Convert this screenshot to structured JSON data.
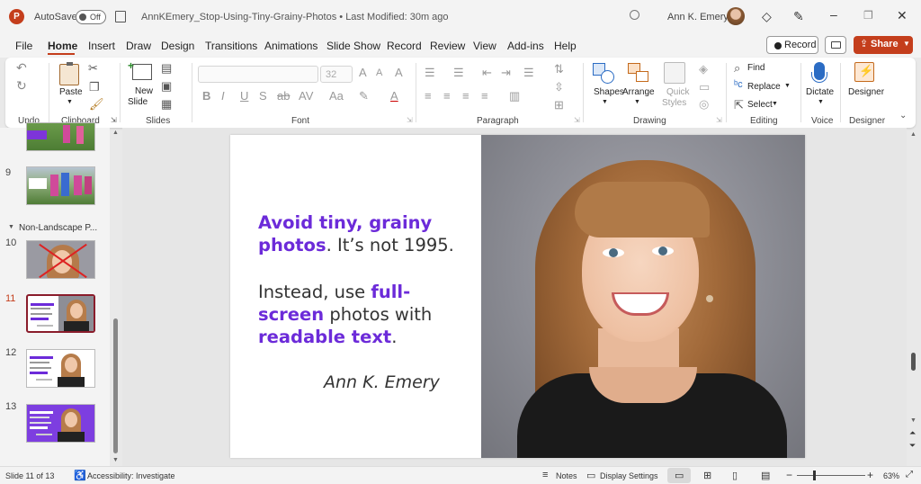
{
  "titlebar": {
    "autosave_label": "AutoSave",
    "autosave_state": "Off",
    "doc_title": "AnnKEmery_Stop-Using-Tiny-Grainy-Photos • Last Modified: 30m ago",
    "user_name": "Ann K. Emery",
    "app_icon": "powerpoint-icon"
  },
  "menu": {
    "tabs": [
      "File",
      "Home",
      "Insert",
      "Draw",
      "Design",
      "Transitions",
      "Animations",
      "Slide Show",
      "Record",
      "Review",
      "View",
      "Add-ins",
      "Help"
    ],
    "active": "Home",
    "record_button": "Record",
    "share_button": "Share"
  },
  "ribbon": {
    "groups": [
      "Undo",
      "Clipboard",
      "Slides",
      "Font",
      "Paragraph",
      "Drawing",
      "Editing",
      "Voice",
      "Designer"
    ],
    "paste": "Paste",
    "new_slide": "New",
    "new_slide2": "Slide",
    "font_size": "32",
    "shapes": "Shapes",
    "arrange": "Arrange",
    "quick_styles": "Quick",
    "quick_styles2": "Styles",
    "find": "Find",
    "replace": "Replace",
    "select": "Select",
    "dictate": "Dictate",
    "designer": "Designer"
  },
  "thumbnails": {
    "slide_numbers": [
      "9",
      "10",
      "11",
      "12",
      "13"
    ],
    "section_label": "Non-Landscape P...",
    "current": "11"
  },
  "slide": {
    "line1a": "Avoid tiny, grainy",
    "line2a": "photos",
    "line2b": ". It’s not 1995.",
    "line3a": "Instead, use ",
    "line3b": "full-",
    "line4a": "screen",
    "line4b": " photos with",
    "line5a": "readable text",
    "line5b": ".",
    "author": "Ann K. Emery"
  },
  "status": {
    "slide_info": "Slide 11 of 13",
    "accessibility": "Accessibility: Investigate",
    "notes": "Notes",
    "display_settings": "Display Settings",
    "zoom": "63%"
  },
  "colors": {
    "accent": "#6c2bd9",
    "share": "#c43e1c",
    "active_tab": "#c43e1c"
  }
}
